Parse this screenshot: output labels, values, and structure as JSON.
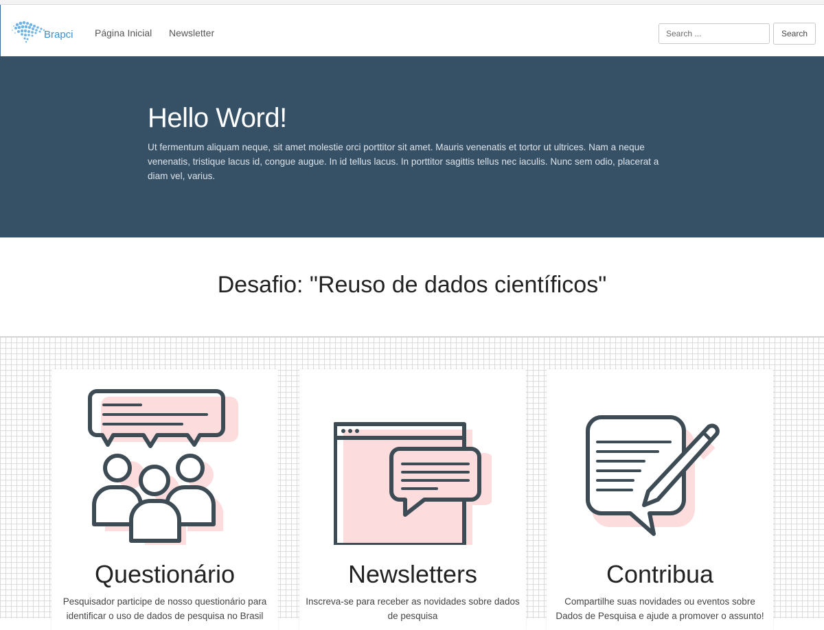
{
  "navbar": {
    "brand": "Brapci",
    "links": [
      {
        "label": "Página Inicial"
      },
      {
        "label": "Newsletter"
      }
    ],
    "search": {
      "placeholder": "Search ...",
      "button_label": "Search"
    }
  },
  "hero": {
    "title": "Hello Word!",
    "text": "Ut fermentum aliquam neque, sit amet molestie orci porttitor sit amet. Mauris venenatis et tortor ut ultrices. Nam a neque venenatis, tristique lacus id, congue augue. In id tellus lacus. In porttitor sagittis tellus nec iaculis. Nunc sem odio, placerat a diam vel, varius."
  },
  "section": {
    "title": "Desafio: \"Reuso de dados científicos\""
  },
  "cards": [
    {
      "icon": "survey-group-icon",
      "title": "Questionário",
      "text": "Pesquisador participe de nosso questionário para identificar o uso de dados de pesquisa no Brasil"
    },
    {
      "icon": "newsletter-window-icon",
      "title": "Newsletters",
      "text": "Inscreva-se para receber as novidades sobre dados de pesquisa"
    },
    {
      "icon": "contribute-pencil-icon",
      "title": "Contribua",
      "text": "Compartilhe suas novidades ou eventos sobre Dados de Pesquisa e ajude a promover o assunto!"
    }
  ],
  "colors": {
    "hero_bg": "#365066",
    "icon_stroke": "#3d4b55",
    "icon_accent": "#fcdcdc",
    "brand": "#3f8fcf"
  }
}
